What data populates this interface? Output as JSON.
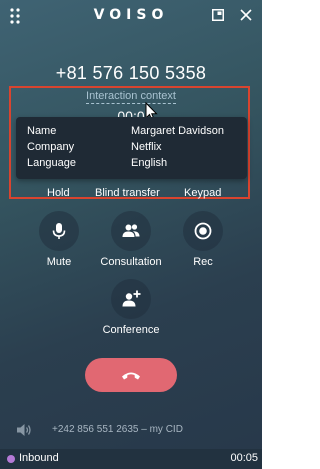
{
  "header": {
    "brand": "VOISO",
    "menu_icon": "dots-grid-icon",
    "minimize_icon": "window-minimize-icon",
    "close_icon": "close-icon"
  },
  "call": {
    "phone_number": "+81 576 150 5358",
    "interaction_context_label": "Interaction context",
    "timer_partial": "00:0"
  },
  "context": {
    "rows": [
      {
        "key": "Name",
        "value": "Margaret Davidson"
      },
      {
        "key": "Company",
        "value": "Netflix"
      },
      {
        "key": "Language",
        "value": "English"
      }
    ]
  },
  "actions": {
    "hold": "Hold",
    "blind_transfer": "Blind transfer",
    "keypad": "Keypad"
  },
  "controls": {
    "mute": "Mute",
    "consultation": "Consultation",
    "rec": "Rec",
    "conference": "Conference"
  },
  "footer": {
    "cid_text": "+242 856 551 2635 – my CID"
  },
  "status": {
    "label": "Inbound",
    "time": "00:05"
  },
  "colors": {
    "highlight": "#d9442f",
    "hangup": "#e16872",
    "status_dot": "#b57ad6"
  }
}
